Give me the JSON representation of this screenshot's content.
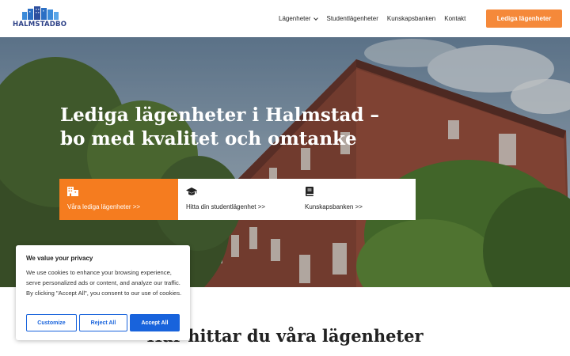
{
  "header": {
    "logo_text": "HALMSTADBO",
    "nav": [
      {
        "label": "Lägenheter",
        "has_dropdown": true
      },
      {
        "label": "Studentlägenheter"
      },
      {
        "label": "Kunskapsbanken"
      },
      {
        "label": "Kontakt"
      }
    ],
    "cta_label": "Lediga lägenheter"
  },
  "hero": {
    "title": "Lediga lägenheter i Halmstad – bo med kvalitet och omtanke",
    "cards": [
      {
        "label": "Våra lediga lägenheter >>",
        "icon": "building-icon",
        "active": true
      },
      {
        "label": "Hitta din studentlägenhet >>",
        "icon": "graduation-cap-icon"
      },
      {
        "label": "Kunskapsbanken >>",
        "icon": "book-icon"
      }
    ]
  },
  "section": {
    "title": "Här hittar du våra lägenheter"
  },
  "cookie": {
    "title": "We value your privacy",
    "text": "We use cookies to enhance your browsing experience, serve personalized ads or content, and analyze our traffic. By clicking \"Accept All\", you consent to our use of cookies.",
    "customize_label": "Customize",
    "reject_label": "Reject All",
    "accept_label": "Accept All"
  },
  "colors": {
    "accent": "#f5893a",
    "accent_dark": "#f57c1f",
    "consent_blue": "#1863dc",
    "brand_navy": "#2b3f86"
  }
}
